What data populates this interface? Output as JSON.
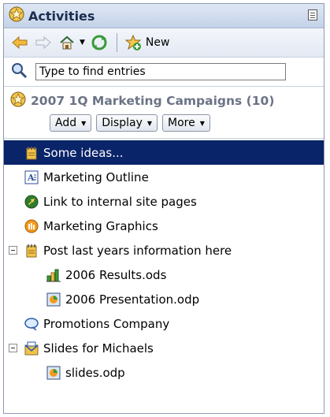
{
  "panel": {
    "title": "Activities"
  },
  "toolbar": {
    "new_label": "New"
  },
  "search": {
    "placeholder": "Type to find entries"
  },
  "activity": {
    "name": "2007 1Q Marketing Campaigns (10)",
    "buttons": [
      "Add",
      "Display",
      "More"
    ]
  },
  "items": [
    {
      "label": "Some ideas...",
      "icon": "notebook-icon",
      "selected": true
    },
    {
      "label": "Marketing Outline",
      "icon": "document-icon"
    },
    {
      "label": "Link to internal site pages",
      "icon": "link-icon"
    },
    {
      "label": "Marketing Graphics",
      "icon": "graphics-icon"
    },
    {
      "label": "Post last years information here",
      "icon": "notebook-icon",
      "expanded": true
    },
    {
      "label": "2006 Results.ods",
      "icon": "spreadsheet-icon"
    },
    {
      "label": "2006 Presentation.odp",
      "icon": "presentation-icon"
    },
    {
      "label": "Promotions Company",
      "icon": "chat-icon"
    },
    {
      "label": "Slides for Michaels",
      "icon": "mail-folder-icon",
      "expanded": true
    },
    {
      "label": "slides.odp",
      "icon": "presentation-icon"
    }
  ],
  "colors": {
    "selection": "#0a246a",
    "title_text": "#1b2d50",
    "activity_text": "#6b7385"
  }
}
